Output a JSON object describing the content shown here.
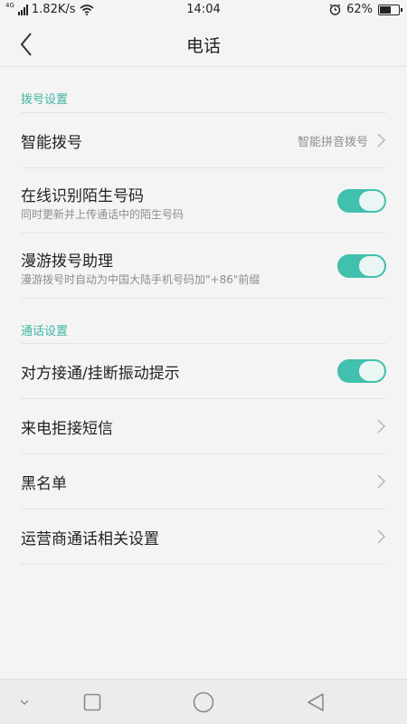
{
  "status_bar": {
    "network_tag": "4G",
    "speed": "1.82K/s",
    "time": "14:04",
    "battery": "62%",
    "battery_level": 0.62,
    "icons": [
      "signal-icon",
      "wifi-icon",
      "alarm-icon",
      "battery-icon"
    ]
  },
  "app_bar": {
    "title": "电话",
    "back_icon": "back-arrow-icon"
  },
  "sections": [
    {
      "header": "拨号设置",
      "items": [
        {
          "title": "智能拨号",
          "value": "智能拼音拨号",
          "control": "chevron"
        },
        {
          "title": "在线识别陌生号码",
          "subtitle": "同时更新并上传通话中的陌生号码",
          "control": "toggle",
          "on": true
        },
        {
          "title": "漫游拨号助理",
          "subtitle": "漫游拨号时自动为中国大陆手机号码加\"+86\"前缀",
          "control": "toggle",
          "on": true
        }
      ]
    },
    {
      "header": "通话设置",
      "items": [
        {
          "title": "对方接通/挂断振动提示",
          "control": "toggle",
          "on": true
        },
        {
          "title": "来电拒接短信",
          "control": "chevron"
        },
        {
          "title": "黑名单",
          "control": "chevron"
        },
        {
          "title": "运营商通话相关设置",
          "control": "chevron"
        }
      ]
    }
  ],
  "nav_bar": {
    "icons": [
      "chevron-down-icon",
      "recents-square-icon",
      "home-circle-icon",
      "back-triangle-icon"
    ]
  },
  "colors": {
    "accent": "#3fb5a3",
    "toggle_on": "#40c0ad",
    "background": "#f4f4f4"
  }
}
